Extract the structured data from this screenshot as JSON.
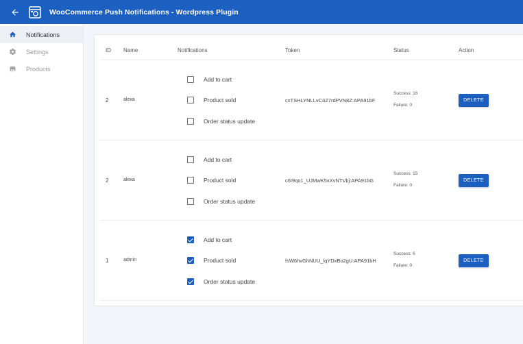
{
  "appbar": {
    "title": "WooCommerce Push Notifications - Wordpress Plugin",
    "back_icon": "arrow-left-icon",
    "logo_icon": "browser-window-logo-icon",
    "color": "#1b5fc1"
  },
  "sidebar": {
    "items": [
      {
        "label": "Notifications",
        "icon": "home-icon",
        "active": true
      },
      {
        "label": "Settings",
        "icon": "gear-icon",
        "active": false
      },
      {
        "label": "Products",
        "icon": "store-icon",
        "active": false
      }
    ]
  },
  "table": {
    "headers": {
      "id": "ID",
      "name": "Name",
      "notifications": "Notifications",
      "token": "Token",
      "status": "Status",
      "action": "Action"
    },
    "rows": [
      {
        "id": "2",
        "name": "alexa",
        "notifications": [
          {
            "label": "Add to cart",
            "checked": false
          },
          {
            "label": "Product sold",
            "checked": false
          },
          {
            "label": "Order status update",
            "checked": false
          }
        ],
        "token": "cxTSHLYNLLvC3Z7rdPVN8Z:APA91bF",
        "success": "Success: 16",
        "failure": "Failure: 0",
        "action_label": "DELETE"
      },
      {
        "id": "2",
        "name": "alexa",
        "notifications": [
          {
            "label": "Add to cart",
            "checked": false
          },
          {
            "label": "Product sold",
            "checked": false
          },
          {
            "label": "Order status update",
            "checked": false
          }
        ],
        "token": "c6I9qo1_UJMwK5xXvNTVbj:APA91bG",
        "success": "Success: 15",
        "failure": "Failure: 0",
        "action_label": "DELETE"
      },
      {
        "id": "1",
        "name": "admin",
        "notifications": [
          {
            "label": "Add to cart",
            "checked": true
          },
          {
            "label": "Product sold",
            "checked": true
          },
          {
            "label": "Order status update",
            "checked": true
          }
        ],
        "token": "fsW6hvGhNUU_lqYDxBo2gU:APA91bH",
        "success": "Success: 6",
        "failure": "Failure: 0",
        "action_label": "DELETE"
      }
    ]
  }
}
